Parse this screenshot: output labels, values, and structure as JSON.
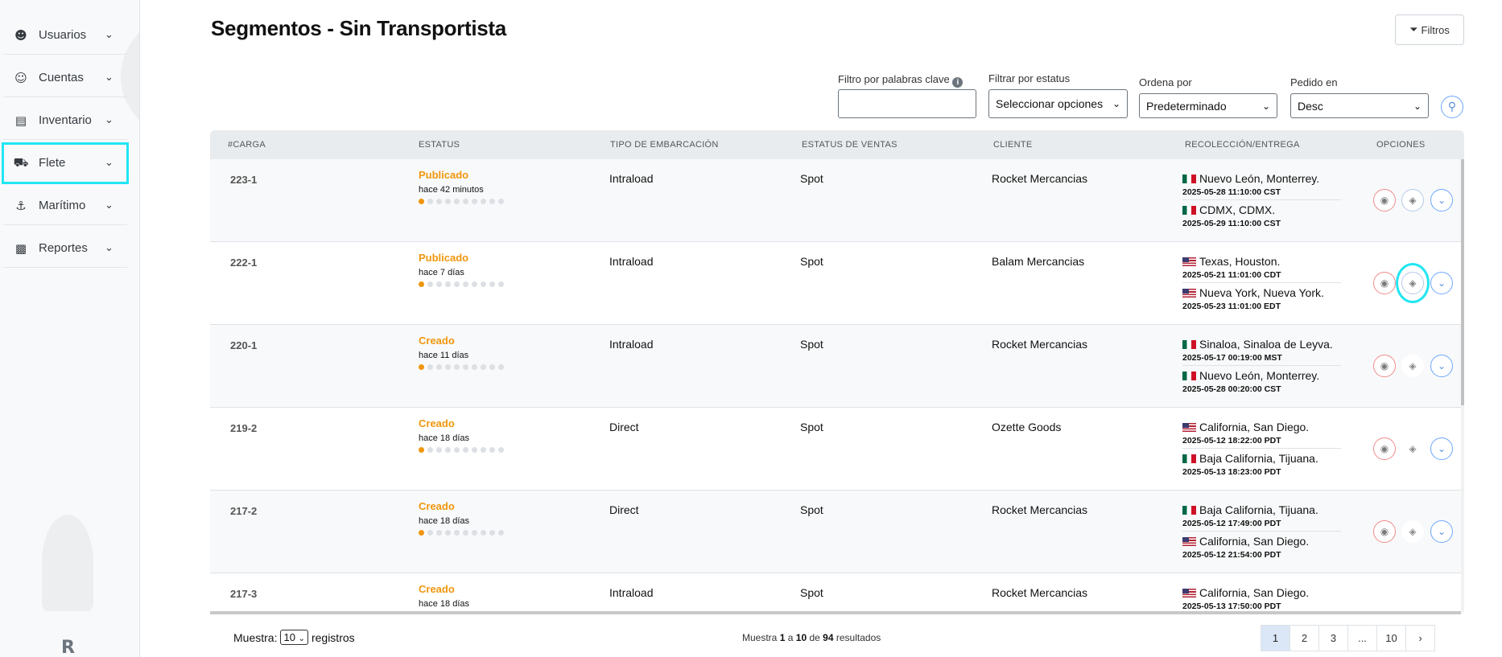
{
  "sidebar": {
    "items": [
      {
        "label": "Usuarios",
        "icon": "users-icon"
      },
      {
        "label": "Cuentas",
        "icon": "accounts-icon"
      },
      {
        "label": "Inventario",
        "icon": "clipboard-icon"
      },
      {
        "label": "Flete",
        "icon": "truck-icon"
      },
      {
        "label": "Marítimo",
        "icon": "ship-icon"
      },
      {
        "label": "Reportes",
        "icon": "chart-icon"
      }
    ],
    "logo_text": "R"
  },
  "header": {
    "title": "Segmentos - Sin Transportista",
    "filters_button": "Filtros"
  },
  "filters": {
    "keyword_label": "Filtro por palabras clave",
    "keyword_value": "",
    "status_label": "Filtrar por estatus",
    "status_value": "Seleccionar opciones",
    "sort_label": "Ordena por",
    "sort_value": "Predeterminado",
    "order_label": "Pedido en",
    "order_value": "Desc"
  },
  "table": {
    "columns": [
      "#CARGA",
      "ESTATUS",
      "TIPO DE EMBARCACIÓN",
      "ESTATUS DE VENTAS",
      "CLIENTE",
      "RECOLECCIÓN/ENTREGA",
      "OPCIONES"
    ],
    "rows": [
      {
        "carga": "223-1",
        "status": "Publicado",
        "ago": "hace 42 minutos",
        "tipo": "Intraload",
        "ventas": "Spot",
        "cliente": "Rocket Mercancias",
        "origin": "Nuevo León, Monterrey.",
        "origin_flag": "mx",
        "origin_ts": "2025-05-28 11:10:00 CST",
        "dest": "CDMX, CDMX.",
        "dest_flag": "mx",
        "dest_ts": "2025-05-29 11:10:00 CST"
      },
      {
        "carga": "222-1",
        "status": "Publicado",
        "ago": "hace 7 días",
        "tipo": "Intraload",
        "ventas": "Spot",
        "cliente": "Balam Mercancias",
        "origin": "Texas, Houston.",
        "origin_flag": "us",
        "origin_ts": "2025-05-21 11:01:00 CDT",
        "dest": "Nueva York, Nueva York.",
        "dest_flag": "us",
        "dest_ts": "2025-05-23 11:01:00 EDT"
      },
      {
        "carga": "220-1",
        "status": "Creado",
        "ago": "hace 11 días",
        "tipo": "Intraload",
        "ventas": "Spot",
        "cliente": "Rocket Mercancias",
        "origin": "Sinaloa, Sinaloa de Leyva.",
        "origin_flag": "mx",
        "origin_ts": "2025-05-17 00:19:00 MST",
        "dest": "Nuevo León, Monterrey.",
        "dest_flag": "mx",
        "dest_ts": "2025-05-28 00:20:00 CST"
      },
      {
        "carga": "219-2",
        "status": "Creado",
        "ago": "hace 18 días",
        "tipo": "Direct",
        "ventas": "Spot",
        "cliente": "Ozette Goods",
        "origin": "California, San Diego.",
        "origin_flag": "us",
        "origin_ts": "2025-05-12 18:22:00 PDT",
        "dest": "Baja California, Tijuana.",
        "dest_flag": "mx",
        "dest_ts": "2025-05-13 18:23:00 PDT"
      },
      {
        "carga": "217-2",
        "status": "Creado",
        "ago": "hace 18 días",
        "tipo": "Direct",
        "ventas": "Spot",
        "cliente": "Rocket Mercancias",
        "origin": "Baja California, Tijuana.",
        "origin_flag": "mx",
        "origin_ts": "2025-05-12 17:49:00 PDT",
        "dest": "California, San Diego.",
        "dest_flag": "us",
        "dest_ts": "2025-05-12 21:54:00 PDT"
      },
      {
        "carga": "217-3",
        "status": "Creado",
        "ago": "hace 18 días",
        "tipo": "Intraload",
        "ventas": "Spot",
        "cliente": "Rocket Mercancias",
        "origin": "California, San Diego.",
        "origin_flag": "us",
        "origin_ts": "2025-05-13 17:50:00 PDT",
        "dest": "",
        "dest_flag": "",
        "dest_ts": ""
      }
    ]
  },
  "footer": {
    "show_label": "Muestra:",
    "page_size": "10",
    "records_label": "registros",
    "summary_prefix": "Muestra",
    "from": "1",
    "a": "a",
    "to": "10",
    "de": "de",
    "total": "94",
    "summary_suffix": "resultados",
    "pages": [
      "1",
      "2",
      "3",
      "...",
      "10",
      "›"
    ]
  },
  "colors": {
    "accent_highlight": "#21e6f2",
    "status_orange": "#f0960e",
    "eye_border": "#f08c8c",
    "more_border": "#6ea8fe"
  }
}
